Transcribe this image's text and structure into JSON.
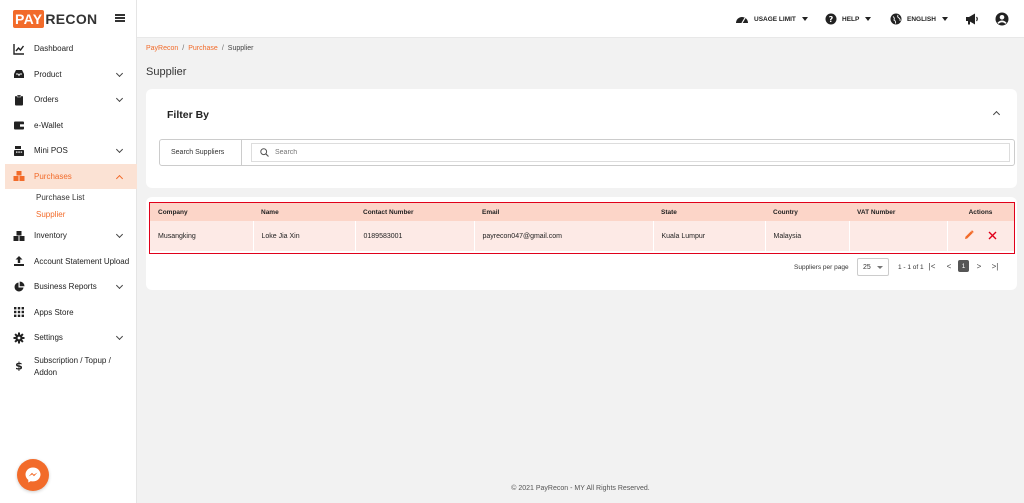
{
  "brand": {
    "logo_pay": "PAY",
    "logo_recon": "RECON",
    "accent": "#f26b2a"
  },
  "sidebar": {
    "items": [
      {
        "label": "Dashboard",
        "icon": "chart-line-icon"
      },
      {
        "label": "Product",
        "icon": "inbox-icon"
      },
      {
        "label": "Orders",
        "icon": "clipboard-icon"
      },
      {
        "label": "e-Wallet",
        "icon": "wallet-icon"
      },
      {
        "label": "Mini POS",
        "icon": "pos-register-icon"
      },
      {
        "label": "Purchases",
        "icon": "boxes-icon"
      },
      {
        "label": "Inventory",
        "icon": "inventory-boxes-icon"
      },
      {
        "label": "Account Statement Upload",
        "icon": "upload-icon"
      },
      {
        "label": "Business Reports",
        "icon": "pie-chart-icon"
      },
      {
        "label": "Apps Store",
        "icon": "grid-icon"
      },
      {
        "label": "Settings",
        "icon": "gear-icon"
      },
      {
        "label": "Subscription / Topup / Addon",
        "icon": "dollar-icon"
      }
    ],
    "purchases_sub": [
      {
        "label": "Purchase List"
      },
      {
        "label": "Supplier"
      }
    ]
  },
  "topbar": {
    "usage_limit": "USAGE LIMIT",
    "help": "HELP",
    "language": "ENGLISH"
  },
  "breadcrumb": {
    "root": "PayRecon",
    "section": "Purchase",
    "current": "Supplier"
  },
  "page_title": "Supplier",
  "filter": {
    "title": "Filter By",
    "search_label": "Search Suppliers",
    "search_placeholder": "Search",
    "search_value": ""
  },
  "table": {
    "columns": [
      "Company",
      "Name",
      "Contact Number",
      "Email",
      "State",
      "Country",
      "VAT Number",
      "Actions"
    ],
    "rows": [
      {
        "company": "Musangking",
        "name": "Loke Jia Xin",
        "contact": "0189583001",
        "email": "payrecon047@gmail.com",
        "state": "Kuala Lumpur",
        "country": "Malaysia",
        "vat": ""
      }
    ]
  },
  "pagination": {
    "per_page_label": "Suppliers per page",
    "per_page": "25",
    "range": "1 - 1 of 1",
    "current_page": "1"
  },
  "footer": "© 2021 PayRecon - MY All Rights Reserved."
}
